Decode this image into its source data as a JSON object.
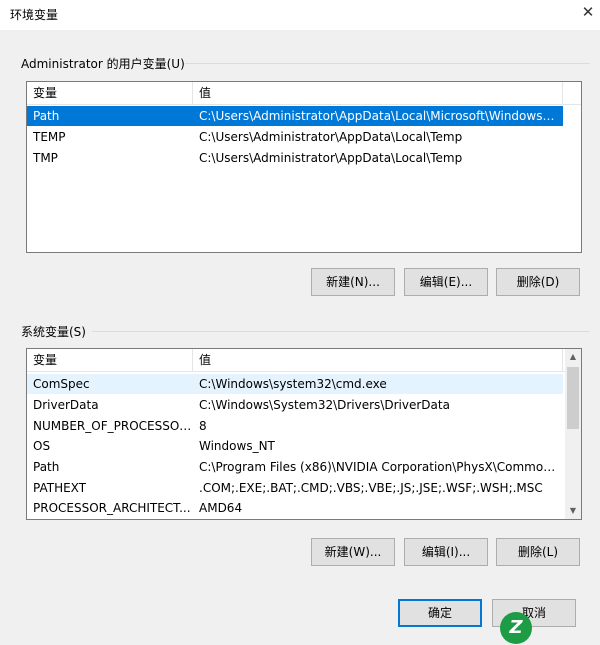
{
  "window": {
    "title": "环境变量",
    "close_glyph": "✕"
  },
  "user_vars": {
    "group_label": "Administrator 的用户变量(U)",
    "columns": [
      "变量",
      "值"
    ],
    "rows": [
      {
        "name": "Path",
        "value": "C:\\Users\\Administrator\\AppData\\Local\\Microsoft\\WindowsA..."
      },
      {
        "name": "TEMP",
        "value": "C:\\Users\\Administrator\\AppData\\Local\\Temp"
      },
      {
        "name": "TMP",
        "value": "C:\\Users\\Administrator\\AppData\\Local\\Temp"
      }
    ],
    "selected_row": 0,
    "buttons": {
      "new": "新建(N)...",
      "edit": "编辑(E)...",
      "delete": "删除(D)"
    }
  },
  "system_vars": {
    "group_label": "系统变量(S)",
    "columns": [
      "变量",
      "值"
    ],
    "rows": [
      {
        "name": "ComSpec",
        "value": "C:\\Windows\\system32\\cmd.exe"
      },
      {
        "name": "DriverData",
        "value": "C:\\Windows\\System32\\Drivers\\DriverData"
      },
      {
        "name": "NUMBER_OF_PROCESSORS",
        "value": "8"
      },
      {
        "name": "OS",
        "value": "Windows_NT"
      },
      {
        "name": "Path",
        "value": "C:\\Program Files (x86)\\NVIDIA Corporation\\PhysX\\Common;..."
      },
      {
        "name": "PATHEXT",
        "value": ".COM;.EXE;.BAT;.CMD;.VBS;.VBE;.JS;.JSE;.WSF;.WSH;.MSC"
      },
      {
        "name": "PROCESSOR_ARCHITECT...",
        "value": "AMD64"
      }
    ],
    "hover_row": 0,
    "buttons": {
      "new": "新建(W)...",
      "edit": "编辑(I)...",
      "delete": "删除(L)"
    }
  },
  "footer": {
    "ok": "确定",
    "cancel": "取消"
  },
  "colors": {
    "selection": "#0078d7",
    "hover": "#e5f3ff",
    "window_bg": "#f0f0f0"
  },
  "icons": {
    "scroll_up": "up-arrow-icon",
    "scroll_down": "down-arrow-icon",
    "logo": "z-logo"
  },
  "logo_text": "Z"
}
